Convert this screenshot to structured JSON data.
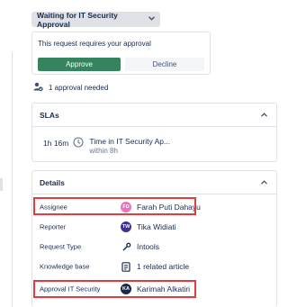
{
  "status": {
    "label": "Waiting for IT Security Approval",
    "icon": "chevron-down-icon"
  },
  "approval": {
    "message": "This request requires your approval",
    "approve_label": "Approve",
    "decline_label": "Decline"
  },
  "approvals_needed": {
    "text": "1 approval needed",
    "icon": "approval-people-icon"
  },
  "slas": {
    "title": "SLAs",
    "items": [
      {
        "time": "1h 16m",
        "name": "Time in IT Security Ap...",
        "target": "within 8h",
        "icon": "clock-icon"
      }
    ]
  },
  "details": {
    "title": "Details",
    "rows": [
      {
        "label": "Assignee",
        "value": "Farah Puti Dahayu",
        "avatar_initials": "FD",
        "avatar_color": "#e774bb"
      },
      {
        "label": "Reporter",
        "value": "Tika Widiati",
        "avatar_initials": "TW",
        "avatar_color": "#403294"
      },
      {
        "label": "Request Type",
        "value": "Intools",
        "icon": "request-type-icon"
      },
      {
        "label": "Knowledge base",
        "value": "1 related article",
        "icon": "article-icon"
      },
      {
        "label": "Approval IT Security",
        "value": "Karimah Alkatiri",
        "avatar_initials": "KA",
        "avatar_color": "#172b4d"
      }
    ]
  },
  "colors": {
    "approve": "#36845d",
    "highlight": "#e03e3e",
    "status_bg": "#dfe1e6"
  }
}
